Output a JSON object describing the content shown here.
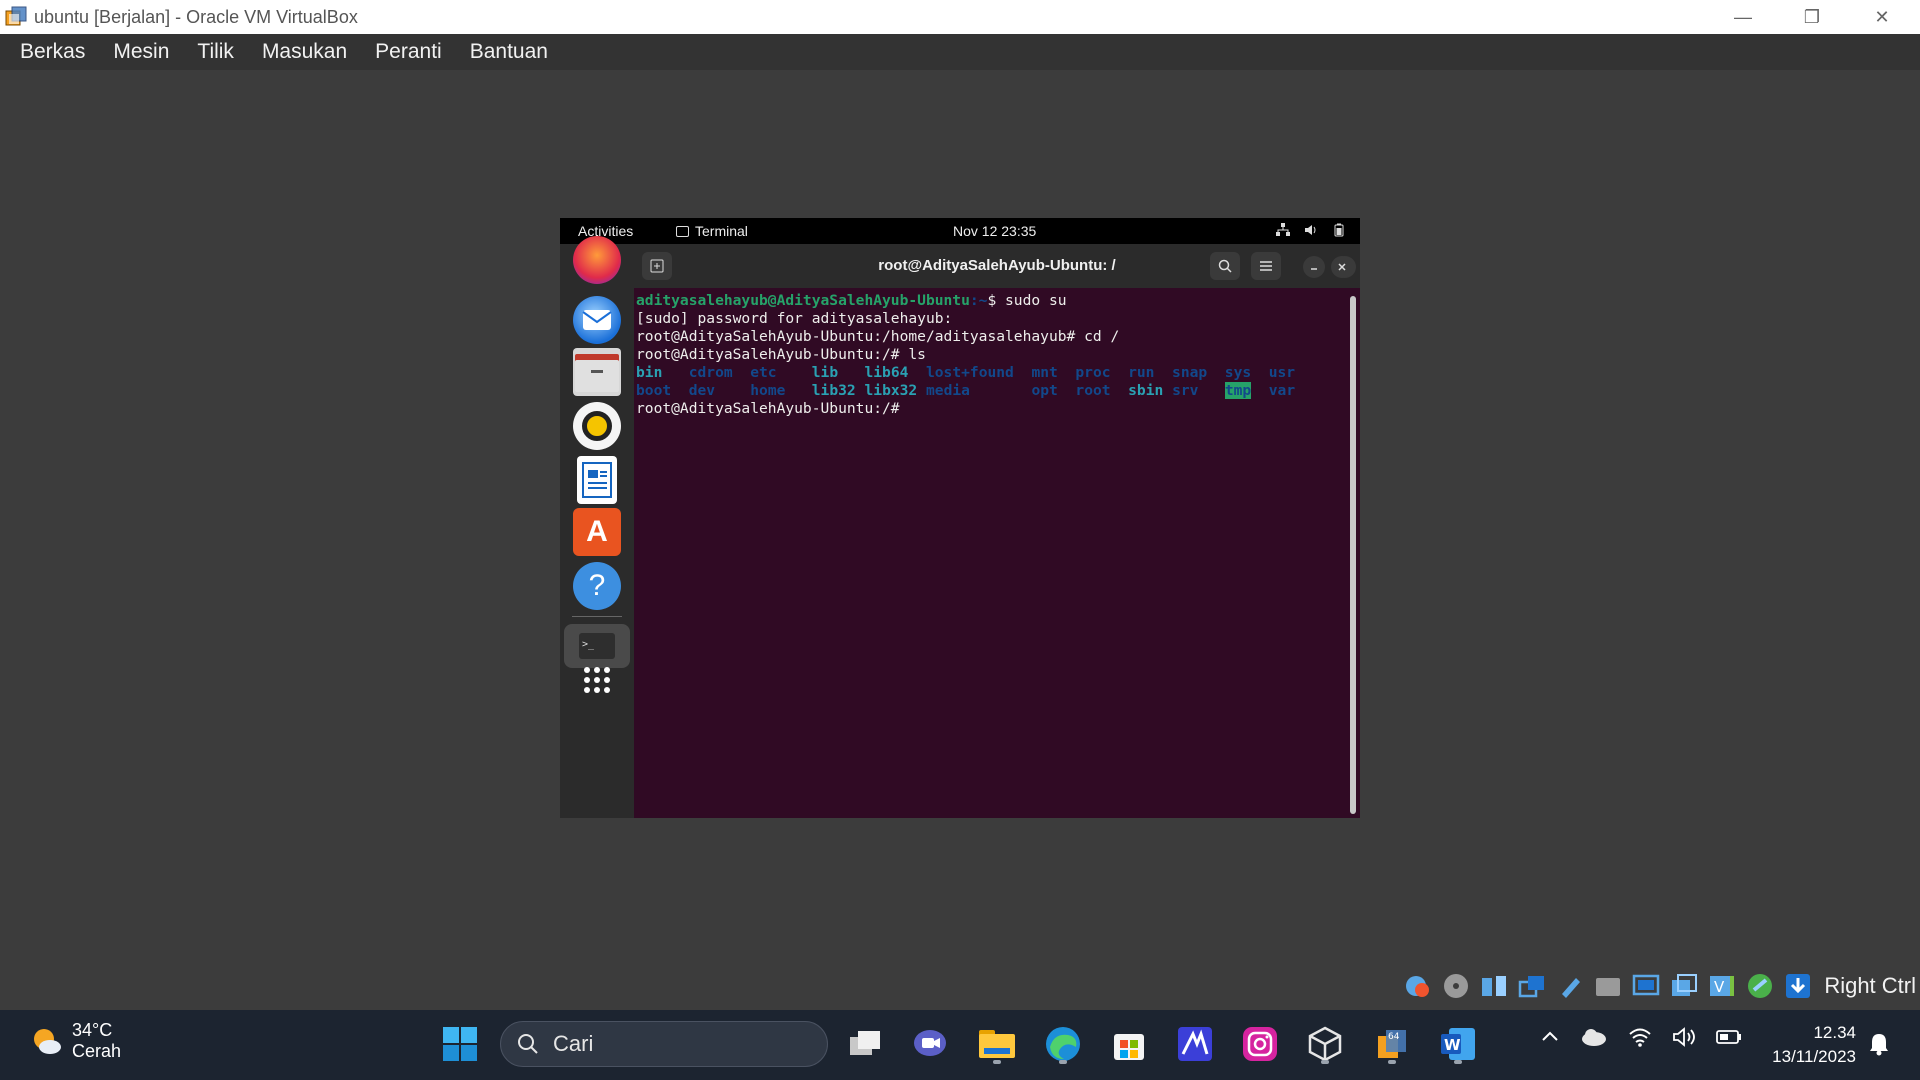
{
  "window": {
    "title": "ubuntu [Berjalan] - Oracle VM VirtualBox",
    "minimize_glyph": "—",
    "restore_glyph": "❐",
    "close_glyph": "✕"
  },
  "menubar": {
    "items": [
      "Berkas",
      "Mesin",
      "Tilik",
      "Masukan",
      "Peranti",
      "Bantuan"
    ]
  },
  "gnome": {
    "activities": "Activities",
    "app_menu": "Terminal",
    "clock": "Nov 12  23:35",
    "dock_apps": [
      "firefox-icon",
      "thunderbird-icon",
      "files-icon",
      "rhythmbox-icon",
      "writer-icon",
      "app-center-icon",
      "help-icon",
      "terminal-icon",
      "show-apps-icon"
    ]
  },
  "terminal": {
    "title": "root@AdityaSalehAyub-Ubuntu: /",
    "line1_user": "adityasalehayub@AdityaSalehAyub-Ubuntu",
    "line1_path": ":~",
    "line1_cmd": "$ sudo su",
    "line2": "[sudo] password for adityasalehayub:",
    "line3": "root@AdityaSalehAyub-Ubuntu:/home/adityasalehayub# cd /",
    "line4": "root@AdityaSalehAyub-Ubuntu:/# ls",
    "ls_row1": [
      {
        "text": "bin",
        "style": "c-cyan"
      },
      {
        "text": "cdrom",
        "style": "c-blue"
      },
      {
        "text": "etc",
        "style": "c-blue"
      },
      {
        "text": "lib",
        "style": "c-cyan"
      },
      {
        "text": "lib64",
        "style": "c-cyan"
      },
      {
        "text": "lost+found",
        "style": "c-blue"
      },
      {
        "text": "mnt",
        "style": "c-blue"
      },
      {
        "text": "proc",
        "style": "c-blue"
      },
      {
        "text": "run",
        "style": "c-blue"
      },
      {
        "text": "snap",
        "style": "c-blue"
      },
      {
        "text": "sys",
        "style": "c-blue"
      },
      {
        "text": "usr",
        "style": "c-blue"
      }
    ],
    "ls_row2": [
      {
        "text": "boot",
        "style": "c-blue"
      },
      {
        "text": "dev",
        "style": "c-blue"
      },
      {
        "text": "home",
        "style": "c-blue"
      },
      {
        "text": "lib32",
        "style": "c-cyan"
      },
      {
        "text": "libx32",
        "style": "c-cyan"
      },
      {
        "text": "media",
        "style": "c-blue"
      },
      {
        "text": "opt",
        "style": "c-blue"
      },
      {
        "text": "root",
        "style": "c-blue"
      },
      {
        "text": "sbin",
        "style": "c-cyan"
      },
      {
        "text": "srv",
        "style": "c-blue"
      },
      {
        "text": "tmp",
        "style": "c-hl"
      },
      {
        "text": "var",
        "style": "c-blue"
      }
    ],
    "line_prompt": "root@AdityaSalehAyub-Ubuntu:/# "
  },
  "vbox_status": {
    "host_key": "Right Ctrl",
    "icons": [
      "hard-disk-icon",
      "optical-drive-icon",
      "audio-icon",
      "network-icon",
      "usb-icon",
      "shared-folder-icon",
      "display-icon",
      "screen-capture-icon",
      "video-recording-icon",
      "mouse-integration-icon",
      "keyboard-icon"
    ]
  },
  "taskbar": {
    "weather_temp": "34°C",
    "weather_cond": "Cerah",
    "search_placeholder": "Cari",
    "clock_time": "12.34",
    "clock_date": "13/11/2023"
  },
  "colors": {
    "terminal_bg": "#300a24",
    "prompt_green": "#26a269",
    "dir_blue": "#12488b",
    "link_cyan": "#2aa1b3",
    "taskbar_bg": "#1c2430"
  }
}
